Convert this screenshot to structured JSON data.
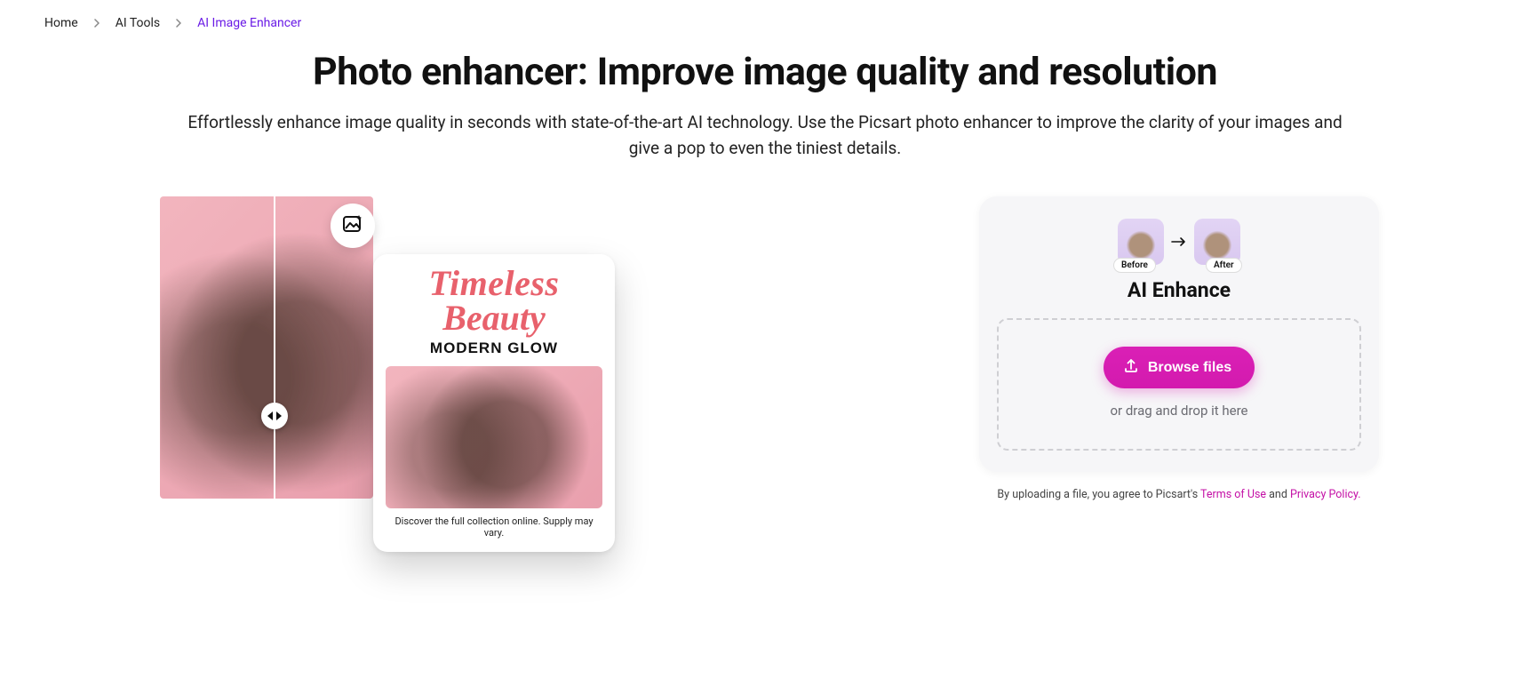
{
  "breadcrumb": {
    "items": [
      {
        "label": "Home"
      },
      {
        "label": "AI Tools"
      },
      {
        "label": "AI Image Enhancer"
      }
    ]
  },
  "hero": {
    "title": "Photo enhancer: Improve image quality and resolution",
    "subtitle": "Effortlessly enhance image quality in seconds with state-of-the-art AI technology. Use the Picsart photo enhancer to improve the clarity of your images and give a pop to even the tiniest details."
  },
  "demo": {
    "card_title_line1": "Timeless",
    "card_title_line2": "Beauty",
    "card_subtitle": "MODERN GLOW",
    "card_caption": "Discover the full collection online. Supply may vary.",
    "magic_icon": "image-sparkle-icon",
    "slider_icon": "compare-slider-icon"
  },
  "upload": {
    "before_label": "Before",
    "after_label": "After",
    "title": "AI Enhance",
    "browse_label": "Browse files",
    "drop_hint": "or drag and drop it here"
  },
  "legal": {
    "prefix": "By uploading a file, you agree to Picsart's ",
    "terms": "Terms of Use",
    "middle": " and ",
    "privacy": "Privacy Policy."
  }
}
